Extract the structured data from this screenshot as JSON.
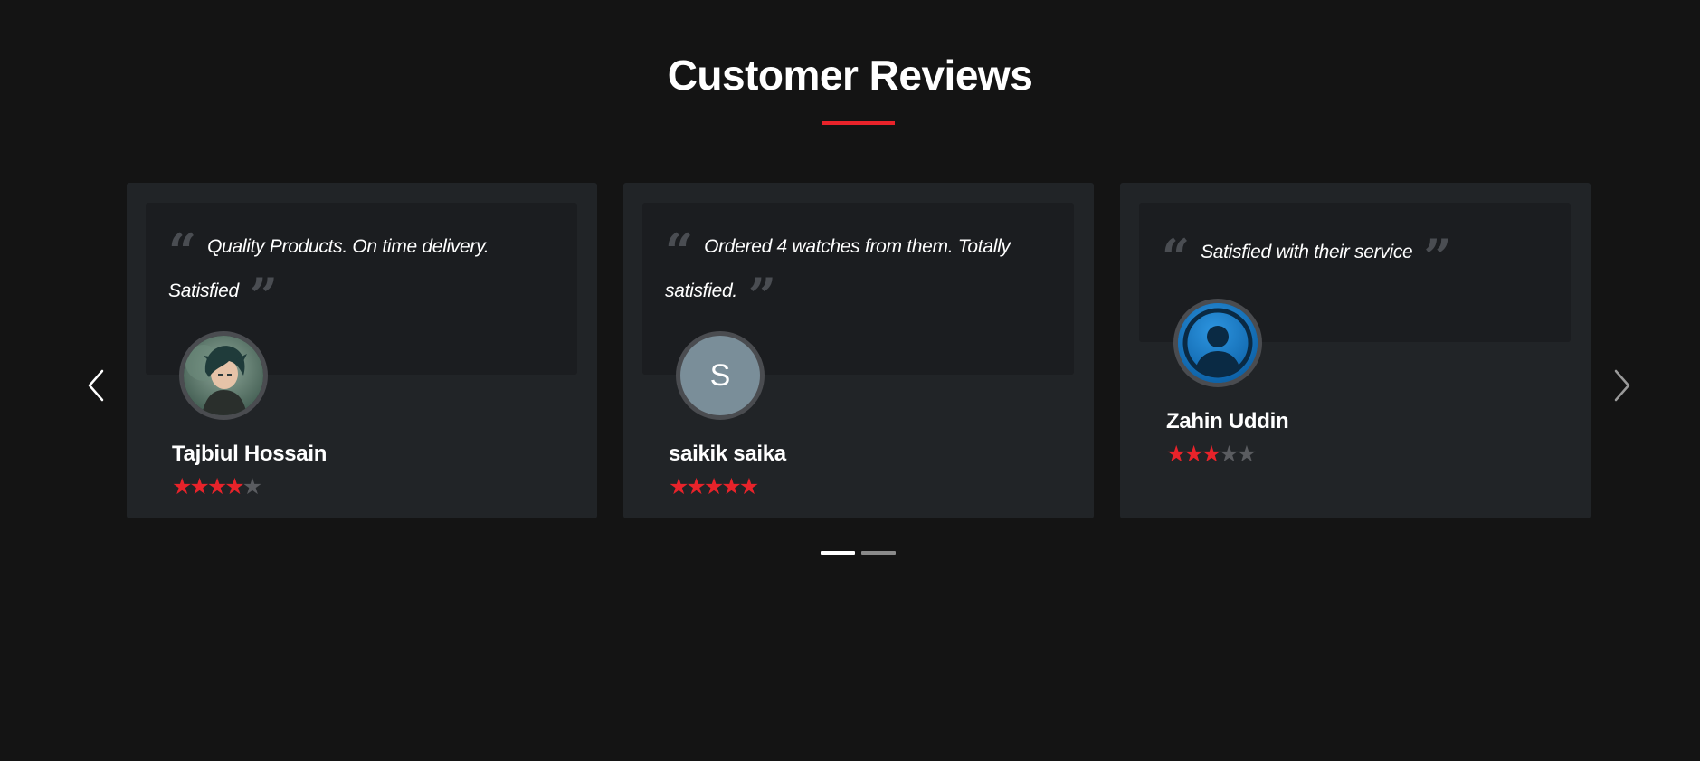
{
  "section": {
    "title": "Customer Reviews"
  },
  "colors": {
    "accent": "#e8232a",
    "star_filled": "#e8232a",
    "star_empty": "#5a5c60",
    "card_bg": "#212427",
    "quote_bg": "#1b1d20"
  },
  "carousel": {
    "prev_icon": "chevron-left-icon",
    "next_icon": "chevron-right-icon",
    "page_count": 2,
    "active_page": 1
  },
  "reviews": [
    {
      "quote": "Quality Products. On time delivery. Satisfied",
      "name": "Tajbiul Hossain",
      "rating": 4,
      "max_rating": 5,
      "avatar_type": "photo"
    },
    {
      "quote": "Ordered 4 watches from them. Totally satisfied.",
      "name": "saikik saika",
      "rating": 5,
      "max_rating": 5,
      "avatar_type": "initial",
      "avatar_initial": "S"
    },
    {
      "quote": "Satisfied with their service",
      "name": "Zahin Uddin",
      "rating": 3,
      "max_rating": 5,
      "avatar_type": "default-user-icon"
    }
  ]
}
